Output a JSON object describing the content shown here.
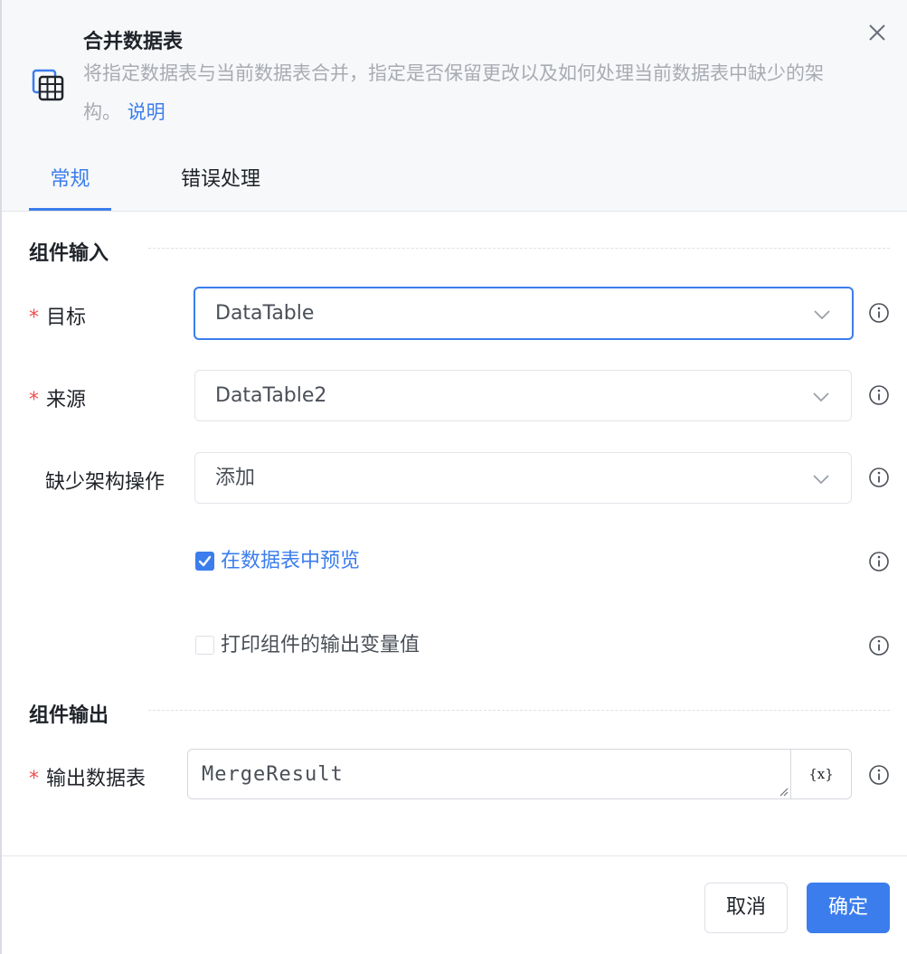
{
  "header": {
    "title": "合并数据表",
    "description": "将指定数据表与当前数据表合并，指定是否保留更改以及如何处理当前数据表中缺少的架构。",
    "help_link": "说明",
    "icon": "table-icon",
    "close_icon": "close-icon"
  },
  "tabs": [
    {
      "label": "常规",
      "active": true
    },
    {
      "label": "错误处理",
      "active": false
    }
  ],
  "input_section": {
    "title": "组件输入"
  },
  "fields": {
    "target": {
      "label": "目标",
      "required": true,
      "value": "DataTable"
    },
    "source": {
      "label": "来源",
      "required": true,
      "value": "DataTable2"
    },
    "missing_schema": {
      "label": "缺少架构操作",
      "required": false,
      "value": "添加"
    }
  },
  "checkboxes": {
    "preview": {
      "label": "在数据表中预览",
      "checked": true
    },
    "print_output": {
      "label": "打印组件的输出变量值",
      "checked": false
    }
  },
  "output_section": {
    "title": "组件输出"
  },
  "output": {
    "label": "输出数据表",
    "required": true,
    "value": "MergeResult",
    "var_button": "{x}"
  },
  "footer": {
    "cancel_label": "取消",
    "ok_label": "确定"
  },
  "colors": {
    "accent": "#3b7ded",
    "required": "#f24e4e",
    "muted": "#a8abb2"
  }
}
